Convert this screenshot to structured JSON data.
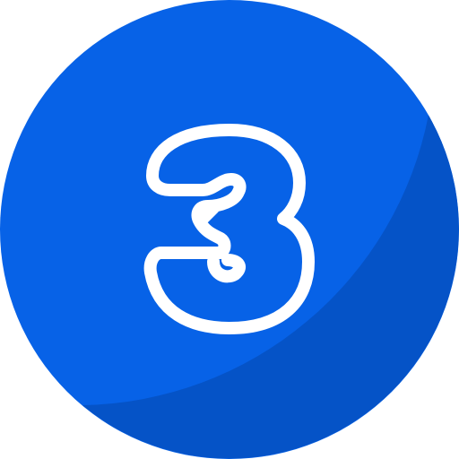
{
  "badge": {
    "number": "3",
    "colors": {
      "fill": "#0762e7",
      "shade": "#0553c7",
      "stroke": "#ffffff"
    }
  }
}
